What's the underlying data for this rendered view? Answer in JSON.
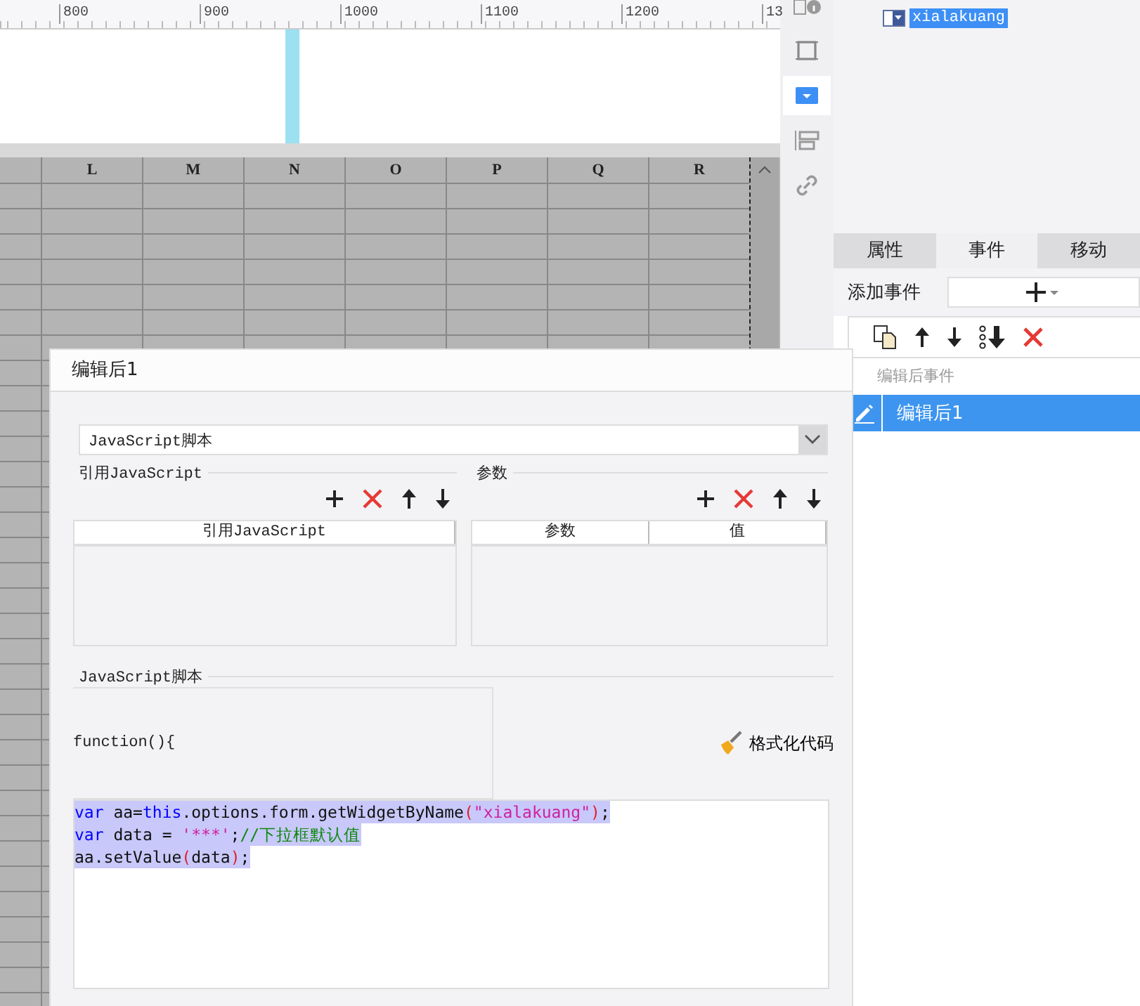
{
  "ruler": {
    "labels": [
      "800",
      "900",
      "1000",
      "1100",
      "1200",
      "13"
    ]
  },
  "sheet": {
    "columns": [
      "L",
      "M",
      "N",
      "O",
      "P",
      "Q",
      "R"
    ]
  },
  "side_tools": [
    {
      "kind": "info",
      "selected": false
    },
    {
      "kind": "frame",
      "selected": false
    },
    {
      "kind": "dropdown",
      "selected": true
    },
    {
      "kind": "layers",
      "selected": false
    },
    {
      "kind": "link",
      "selected": false
    }
  ],
  "tree": {
    "items": [
      {
        "label": "xialakuang",
        "selected": true
      }
    ]
  },
  "tabs": [
    {
      "label": "属性",
      "selected": false
    },
    {
      "label": "事件",
      "selected": true
    },
    {
      "label": "移动",
      "selected": false
    }
  ],
  "add_event": {
    "label": "添加事件"
  },
  "event_toolbar": [
    {
      "kind": "copy"
    },
    {
      "kind": "up"
    },
    {
      "kind": "down"
    },
    {
      "kind": "bottom"
    },
    {
      "kind": "delete"
    }
  ],
  "event_list": {
    "header": "编辑后事件",
    "items": [
      {
        "label": "编辑后1",
        "selected": true
      }
    ]
  },
  "dialog": {
    "title": "编辑后1",
    "type_select": {
      "value": "JavaScript脚本"
    },
    "imports": {
      "title": "引用JavaScript",
      "tools": [
        {
          "kind": "add"
        },
        {
          "kind": "delete"
        },
        {
          "kind": "up"
        },
        {
          "kind": "down"
        }
      ],
      "columns": [
        "引用JavaScript"
      ]
    },
    "params": {
      "title": "参数",
      "tools": [
        {
          "kind": "add"
        },
        {
          "kind": "delete"
        },
        {
          "kind": "up"
        },
        {
          "kind": "down"
        }
      ],
      "columns": [
        "参数",
        "值"
      ]
    },
    "script": {
      "title": "JavaScript脚本",
      "header": "function(){",
      "format_button": "格式化代码",
      "lines": [
        {
          "selected": true,
          "tokens": [
            {
              "kind": "keyword",
              "text": "var"
            },
            {
              "kind": "plain",
              "text": " aa="
            },
            {
              "kind": "keyword",
              "text": "this"
            },
            {
              "kind": "plain",
              "text": ".options.form.getWidgetByName"
            },
            {
              "kind": "paren",
              "text": "("
            },
            {
              "kind": "string",
              "text": "\"xialakuang\""
            },
            {
              "kind": "paren",
              "text": ")"
            },
            {
              "kind": "plain",
              "text": ";"
            }
          ]
        },
        {
          "selected": true,
          "tokens": [
            {
              "kind": "keyword",
              "text": "var"
            },
            {
              "kind": "plain",
              "text": " data = "
            },
            {
              "kind": "string",
              "text": "'***'"
            },
            {
              "kind": "plain",
              "text": ";"
            },
            {
              "kind": "comment",
              "text": "//下拉框默认值"
            }
          ]
        },
        {
          "selected": true,
          "tokens": [
            {
              "kind": "plain",
              "text": "aa.setValue"
            },
            {
              "kind": "paren",
              "text": "("
            },
            {
              "kind": "plain",
              "text": "data"
            },
            {
              "kind": "paren",
              "text": ")"
            },
            {
              "kind": "plain",
              "text": ";"
            }
          ]
        }
      ]
    }
  }
}
